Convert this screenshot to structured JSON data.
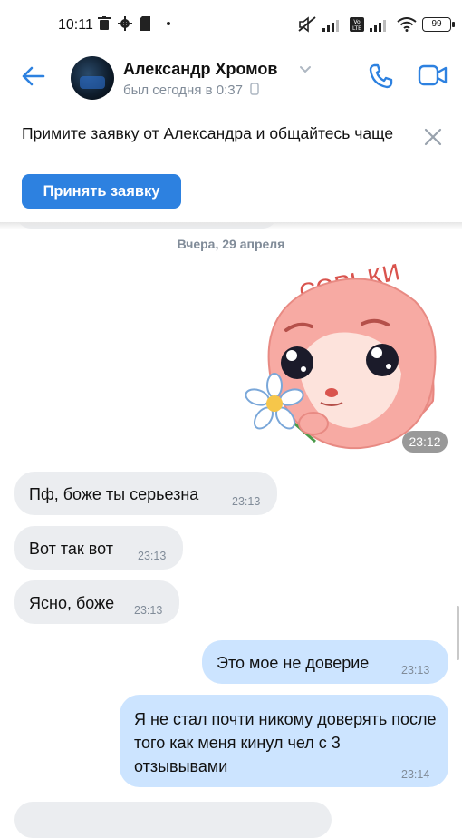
{
  "status_bar": {
    "time": "10:11",
    "battery": "99"
  },
  "header": {
    "contact_name": "Александр Хромов",
    "last_seen": "был сегодня в 0:37"
  },
  "friend_request": {
    "text": "Примите заявку от Александра и общайтесь чаще",
    "accept_label": "Принять заявку"
  },
  "date_separator": "Вчера, 29 апреля",
  "sticker": {
    "caption": "СОРЬКИ",
    "time": "23:12"
  },
  "messages": [
    {
      "direction": "in",
      "text": "Пф, боже ты серьезна",
      "time": "23:13"
    },
    {
      "direction": "in",
      "text": "Вот так вот",
      "time": "23:13"
    },
    {
      "direction": "in",
      "text": "Ясно, боже",
      "time": "23:13"
    },
    {
      "direction": "out",
      "text": "Это мое не доверие",
      "time": "23:13"
    },
    {
      "direction": "out",
      "text": "Я не стал почти никому доверять после того как меня кинул чел с 3 отзывывами",
      "time": "23:14"
    }
  ],
  "colors": {
    "accent": "#2d81e0",
    "incoming_bubble": "#ebedf0",
    "outgoing_bubble": "#cce4ff",
    "meta_text": "#818c99"
  }
}
